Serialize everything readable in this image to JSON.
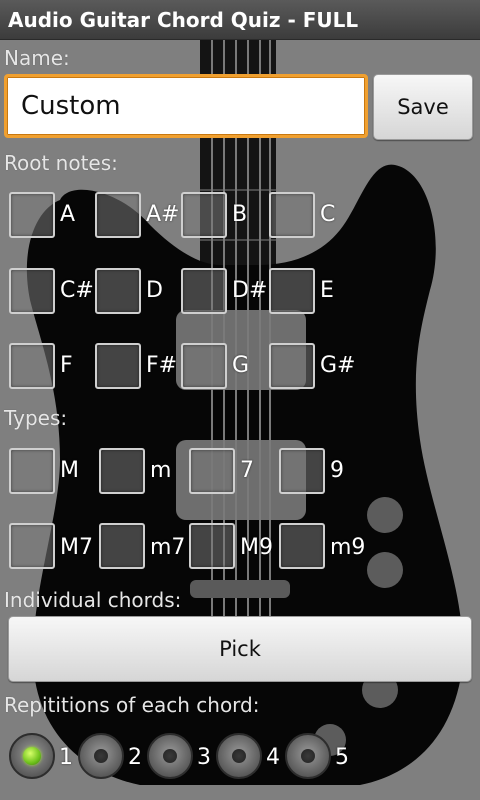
{
  "app": {
    "title": "Audio Guitar Chord Quiz - FULL"
  },
  "name_section": {
    "label": "Name:",
    "input_value": "Custom",
    "save_label": "Save"
  },
  "root_notes": {
    "label": "Root notes:",
    "items": [
      {
        "label": "A",
        "checked": false
      },
      {
        "label": "A#",
        "checked": false
      },
      {
        "label": "B",
        "checked": false
      },
      {
        "label": "C",
        "checked": false
      },
      {
        "label": "C#",
        "checked": false
      },
      {
        "label": "D",
        "checked": false
      },
      {
        "label": "D#",
        "checked": false
      },
      {
        "label": "E",
        "checked": false
      },
      {
        "label": "F",
        "checked": false
      },
      {
        "label": "F#",
        "checked": false
      },
      {
        "label": "G",
        "checked": false
      },
      {
        "label": "G#",
        "checked": false
      }
    ]
  },
  "types": {
    "label": "Types:",
    "items": [
      {
        "label": "M",
        "checked": false
      },
      {
        "label": "m",
        "checked": false
      },
      {
        "label": "7",
        "checked": false
      },
      {
        "label": "9",
        "checked": false
      },
      {
        "label": "M7",
        "checked": false
      },
      {
        "label": "m7",
        "checked": false
      },
      {
        "label": "M9",
        "checked": false
      },
      {
        "label": "m9",
        "checked": false
      }
    ]
  },
  "individual": {
    "label": "Individual chords:",
    "pick_label": "Pick"
  },
  "repetitions": {
    "label": "Repititions of each chord:",
    "options": [
      "1",
      "2",
      "3",
      "4",
      "5"
    ],
    "selected": "1"
  },
  "colors": {
    "accent_focus": "#f0a030",
    "radio_selected": "#6fc21c",
    "background": "#7f7f7f"
  }
}
